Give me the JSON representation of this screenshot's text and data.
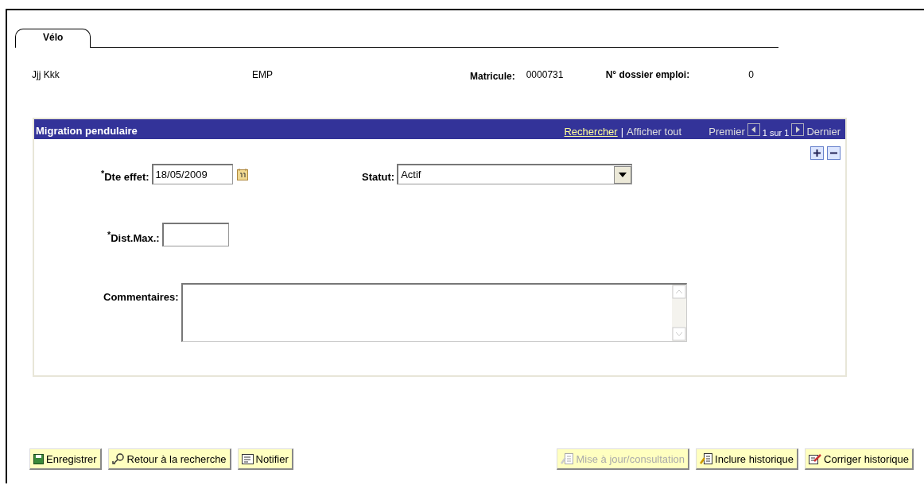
{
  "tabs": [
    {
      "label": "Vélo",
      "selected": true
    }
  ],
  "header": {
    "name": "Jjj Kkk",
    "type": "EMP",
    "id_label": "Matricule:",
    "id_value": "0000731",
    "record_label": "N° dossier emploi:",
    "record_value": "0"
  },
  "panel": {
    "title": "Migration pendulaire",
    "search_link": "Rechercher",
    "separator": "|",
    "show_all": "Afficher tout",
    "first": "Premier",
    "position": "1 sur 1",
    "last": "Dernier",
    "fields": {
      "date_label": "$^{*}$Dte effet:",
      "date_value": "18/05/2009",
      "status_label": "Statut:",
      "status_value": "Actif",
      "dist_label": "$^{*}$Dist.Max.:",
      "comments_label": "Commentaires:"
    }
  },
  "buttons": [
    {
      "label": "Enregistrer",
      "kind": "save",
      "disabled": false
    },
    {
      "label": "Retour à la recherche",
      "kind": "search",
      "disabled": false
    },
    {
      "label": "Notifier",
      "kind": "notify",
      "disabled": false
    },
    {
      "label": "Mise à jour/consultation",
      "kind": "doc",
      "disabled": true
    },
    {
      "label": "Inclure historique",
      "kind": "doc",
      "disabled": false
    },
    {
      "label": "Corriger historique",
      "kind": "edit",
      "disabled": false
    }
  ]
}
